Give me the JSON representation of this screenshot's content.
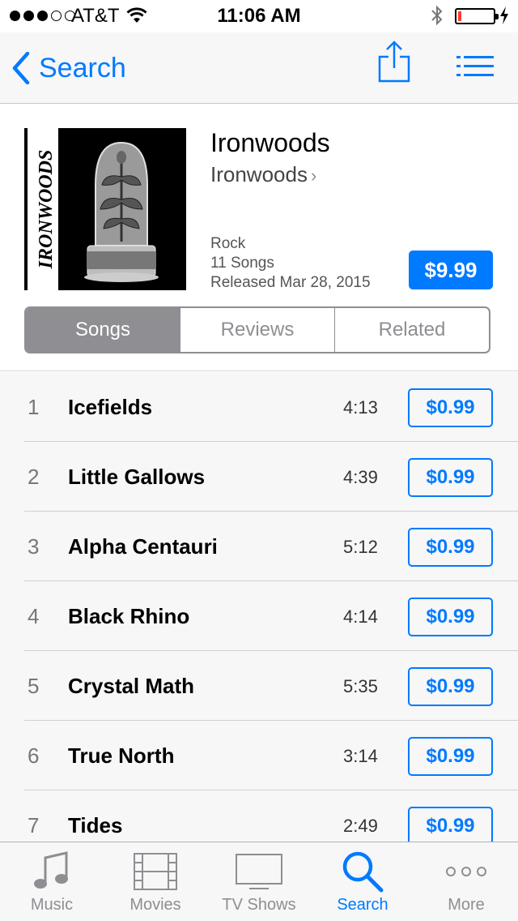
{
  "status_bar": {
    "carrier": "AT&T",
    "time": "11:06 AM",
    "signal_filled": 3,
    "signal_total": 5,
    "battery_level": 0.08
  },
  "nav": {
    "back_label": "Search",
    "accent_color": "#007aff"
  },
  "album": {
    "title": "Ironwoods",
    "artist": "Ironwoods",
    "artist_chevron": "›",
    "genre": "Rock",
    "song_count": "11 Songs",
    "released": "Released Mar 28, 2015",
    "price": "$9.99",
    "artwork_text": "IRONWOODS"
  },
  "segments": [
    {
      "label": "Songs",
      "selected": true
    },
    {
      "label": "Reviews",
      "selected": false
    },
    {
      "label": "Related",
      "selected": false
    }
  ],
  "tracks": [
    {
      "num": "1",
      "title": "Icefields",
      "duration": "4:13",
      "price": "$0.99"
    },
    {
      "num": "2",
      "title": "Little Gallows",
      "duration": "4:39",
      "price": "$0.99"
    },
    {
      "num": "3",
      "title": "Alpha Centauri",
      "duration": "5:12",
      "price": "$0.99"
    },
    {
      "num": "4",
      "title": "Black Rhino",
      "duration": "4:14",
      "price": "$0.99"
    },
    {
      "num": "5",
      "title": "Crystal Math",
      "duration": "5:35",
      "price": "$0.99"
    },
    {
      "num": "6",
      "title": "True North",
      "duration": "3:14",
      "price": "$0.99"
    },
    {
      "num": "7",
      "title": "Tides",
      "duration": "2:49",
      "price": "$0.99"
    }
  ],
  "tab_bar": [
    {
      "label": "Music",
      "icon": "music-note-icon",
      "active": false
    },
    {
      "label": "Movies",
      "icon": "film-strip-icon",
      "active": false
    },
    {
      "label": "TV Shows",
      "icon": "tv-icon",
      "active": false
    },
    {
      "label": "Search",
      "icon": "search-icon",
      "active": true
    },
    {
      "label": "More",
      "icon": "more-dots-icon",
      "active": false
    }
  ]
}
